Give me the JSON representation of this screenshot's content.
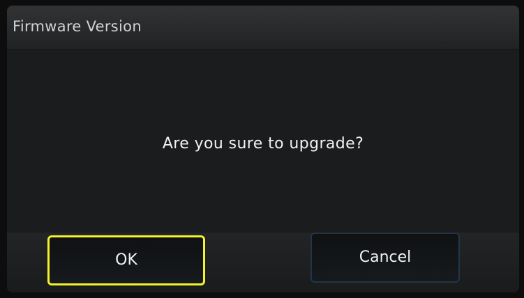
{
  "dialog": {
    "title": "Firmware Version",
    "message": "Are you sure to upgrade?",
    "buttons": {
      "ok_label": "OK",
      "cancel_label": "Cancel"
    },
    "colors": {
      "focus_border": "#f4f22a",
      "background": "#1c1d1e",
      "text": "#f2f2f2"
    }
  }
}
